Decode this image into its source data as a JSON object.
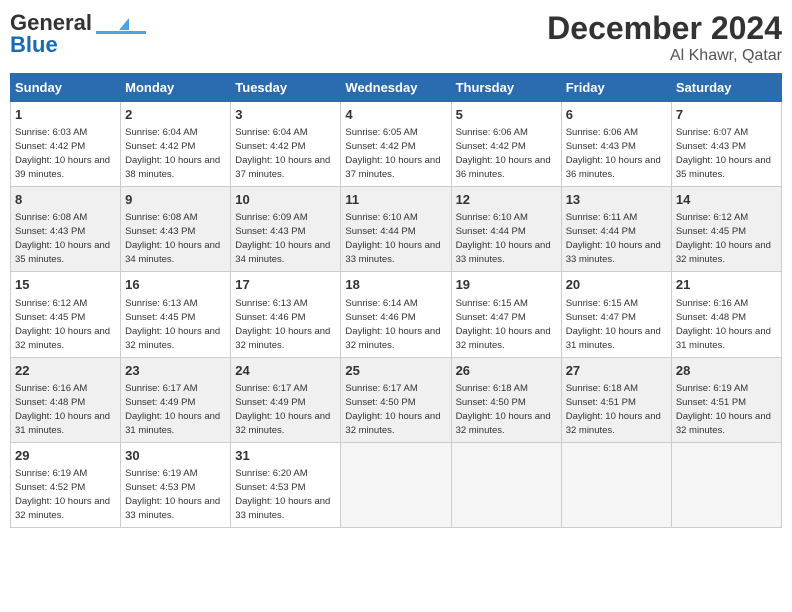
{
  "logo": {
    "line1": "General",
    "line2": "Blue"
  },
  "title": "December 2024",
  "location": "Al Khawr, Qatar",
  "days_of_week": [
    "Sunday",
    "Monday",
    "Tuesday",
    "Wednesday",
    "Thursday",
    "Friday",
    "Saturday"
  ],
  "weeks": [
    [
      {
        "day": "1",
        "sunrise": "6:03 AM",
        "sunset": "4:42 PM",
        "daylight": "10 hours and 39 minutes."
      },
      {
        "day": "2",
        "sunrise": "6:04 AM",
        "sunset": "4:42 PM",
        "daylight": "10 hours and 38 minutes."
      },
      {
        "day": "3",
        "sunrise": "6:04 AM",
        "sunset": "4:42 PM",
        "daylight": "10 hours and 37 minutes."
      },
      {
        "day": "4",
        "sunrise": "6:05 AM",
        "sunset": "4:42 PM",
        "daylight": "10 hours and 37 minutes."
      },
      {
        "day": "5",
        "sunrise": "6:06 AM",
        "sunset": "4:42 PM",
        "daylight": "10 hours and 36 minutes."
      },
      {
        "day": "6",
        "sunrise": "6:06 AM",
        "sunset": "4:43 PM",
        "daylight": "10 hours and 36 minutes."
      },
      {
        "day": "7",
        "sunrise": "6:07 AM",
        "sunset": "4:43 PM",
        "daylight": "10 hours and 35 minutes."
      }
    ],
    [
      {
        "day": "8",
        "sunrise": "6:08 AM",
        "sunset": "4:43 PM",
        "daylight": "10 hours and 35 minutes."
      },
      {
        "day": "9",
        "sunrise": "6:08 AM",
        "sunset": "4:43 PM",
        "daylight": "10 hours and 34 minutes."
      },
      {
        "day": "10",
        "sunrise": "6:09 AM",
        "sunset": "4:43 PM",
        "daylight": "10 hours and 34 minutes."
      },
      {
        "day": "11",
        "sunrise": "6:10 AM",
        "sunset": "4:44 PM",
        "daylight": "10 hours and 33 minutes."
      },
      {
        "day": "12",
        "sunrise": "6:10 AM",
        "sunset": "4:44 PM",
        "daylight": "10 hours and 33 minutes."
      },
      {
        "day": "13",
        "sunrise": "6:11 AM",
        "sunset": "4:44 PM",
        "daylight": "10 hours and 33 minutes."
      },
      {
        "day": "14",
        "sunrise": "6:12 AM",
        "sunset": "4:45 PM",
        "daylight": "10 hours and 32 minutes."
      }
    ],
    [
      {
        "day": "15",
        "sunrise": "6:12 AM",
        "sunset": "4:45 PM",
        "daylight": "10 hours and 32 minutes."
      },
      {
        "day": "16",
        "sunrise": "6:13 AM",
        "sunset": "4:45 PM",
        "daylight": "10 hours and 32 minutes."
      },
      {
        "day": "17",
        "sunrise": "6:13 AM",
        "sunset": "4:46 PM",
        "daylight": "10 hours and 32 minutes."
      },
      {
        "day": "18",
        "sunrise": "6:14 AM",
        "sunset": "4:46 PM",
        "daylight": "10 hours and 32 minutes."
      },
      {
        "day": "19",
        "sunrise": "6:15 AM",
        "sunset": "4:47 PM",
        "daylight": "10 hours and 32 minutes."
      },
      {
        "day": "20",
        "sunrise": "6:15 AM",
        "sunset": "4:47 PM",
        "daylight": "10 hours and 31 minutes."
      },
      {
        "day": "21",
        "sunrise": "6:16 AM",
        "sunset": "4:48 PM",
        "daylight": "10 hours and 31 minutes."
      }
    ],
    [
      {
        "day": "22",
        "sunrise": "6:16 AM",
        "sunset": "4:48 PM",
        "daylight": "10 hours and 31 minutes."
      },
      {
        "day": "23",
        "sunrise": "6:17 AM",
        "sunset": "4:49 PM",
        "daylight": "10 hours and 31 minutes."
      },
      {
        "day": "24",
        "sunrise": "6:17 AM",
        "sunset": "4:49 PM",
        "daylight": "10 hours and 32 minutes."
      },
      {
        "day": "25",
        "sunrise": "6:17 AM",
        "sunset": "4:50 PM",
        "daylight": "10 hours and 32 minutes."
      },
      {
        "day": "26",
        "sunrise": "6:18 AM",
        "sunset": "4:50 PM",
        "daylight": "10 hours and 32 minutes."
      },
      {
        "day": "27",
        "sunrise": "6:18 AM",
        "sunset": "4:51 PM",
        "daylight": "10 hours and 32 minutes."
      },
      {
        "day": "28",
        "sunrise": "6:19 AM",
        "sunset": "4:51 PM",
        "daylight": "10 hours and 32 minutes."
      }
    ],
    [
      {
        "day": "29",
        "sunrise": "6:19 AM",
        "sunset": "4:52 PM",
        "daylight": "10 hours and 32 minutes."
      },
      {
        "day": "30",
        "sunrise": "6:19 AM",
        "sunset": "4:53 PM",
        "daylight": "10 hours and 33 minutes."
      },
      {
        "day": "31",
        "sunrise": "6:20 AM",
        "sunset": "4:53 PM",
        "daylight": "10 hours and 33 minutes."
      },
      null,
      null,
      null,
      null
    ]
  ]
}
